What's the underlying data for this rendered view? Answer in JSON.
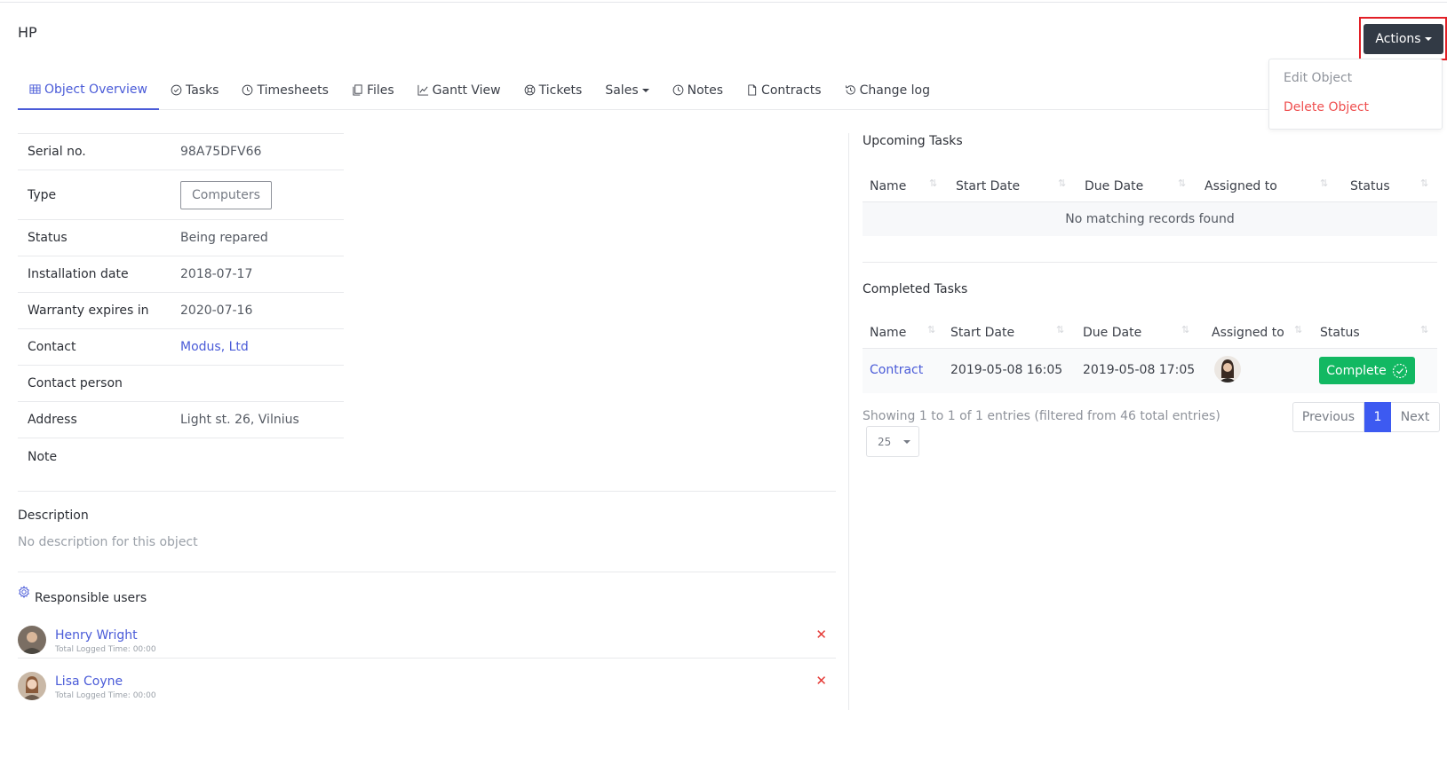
{
  "page": {
    "title": "HP"
  },
  "actions": {
    "label": "Actions",
    "menu": {
      "edit": "Edit Object",
      "delete": "Delete Object"
    }
  },
  "tabs": [
    {
      "label": "Object Overview",
      "icon": "table-icon",
      "active": true
    },
    {
      "label": "Tasks",
      "icon": "check-circle-icon"
    },
    {
      "label": "Timesheets",
      "icon": "clock-icon"
    },
    {
      "label": "Files",
      "icon": "files-icon"
    },
    {
      "label": "Gantt View",
      "icon": "chart-line-icon"
    },
    {
      "label": "Tickets",
      "icon": "life-ring-icon"
    },
    {
      "label": "Sales",
      "icon": "chevron-down-icon"
    },
    {
      "label": "Notes",
      "icon": "clock-icon"
    },
    {
      "label": "Contracts",
      "icon": "file-icon"
    },
    {
      "label": "Change log",
      "icon": "history-icon"
    }
  ],
  "details": {
    "serial": {
      "label": "Serial no.",
      "value": "98A75DFV66"
    },
    "type": {
      "label": "Type",
      "value": "Computers"
    },
    "status": {
      "label": "Status",
      "value": "Being repared"
    },
    "install": {
      "label": "Installation date",
      "value": "2018-07-17"
    },
    "warranty": {
      "label": "Warranty expires in",
      "value": "2020-07-16"
    },
    "contact": {
      "label": "Contact",
      "value": "Modus, Ltd"
    },
    "contact_person": {
      "label": "Contact person",
      "value": ""
    },
    "address": {
      "label": "Address",
      "value": "Light st. 26, Vilnius"
    },
    "note": {
      "label": "Note",
      "value": ""
    }
  },
  "description": {
    "title": "Description",
    "text": "No description for this object"
  },
  "responsible": {
    "title": "Responsible users",
    "users": [
      {
        "name": "Henry Wright",
        "sub": "Total Logged Time: 00:00"
      },
      {
        "name": "Lisa Coyne",
        "sub": "Total Logged Time: 00:00"
      }
    ]
  },
  "upcoming": {
    "title": "Upcoming Tasks",
    "columns": [
      "Name",
      "Start Date",
      "Due Date",
      "Assigned to",
      "Status"
    ],
    "empty": "No matching records found"
  },
  "completed": {
    "title": "Completed Tasks",
    "columns": [
      "Name",
      "Start Date",
      "Due Date",
      "Assigned to",
      "Status"
    ],
    "rows": [
      {
        "name": "Contract",
        "start": "2019-05-08 16:05",
        "due": "2019-05-08 17:05",
        "status": "Complete"
      }
    ],
    "showing": "Showing 1 to 1 of 1 entries (filtered from 46 total entries)",
    "pager": {
      "prev": "Previous",
      "current": "1",
      "next": "Next"
    },
    "page_size": "25"
  },
  "colors": {
    "accent": "#4a5bd8",
    "danger": "#ef4f4f",
    "success": "#12b862",
    "dark_button": "#323a45",
    "highlight": "#e21f26"
  }
}
